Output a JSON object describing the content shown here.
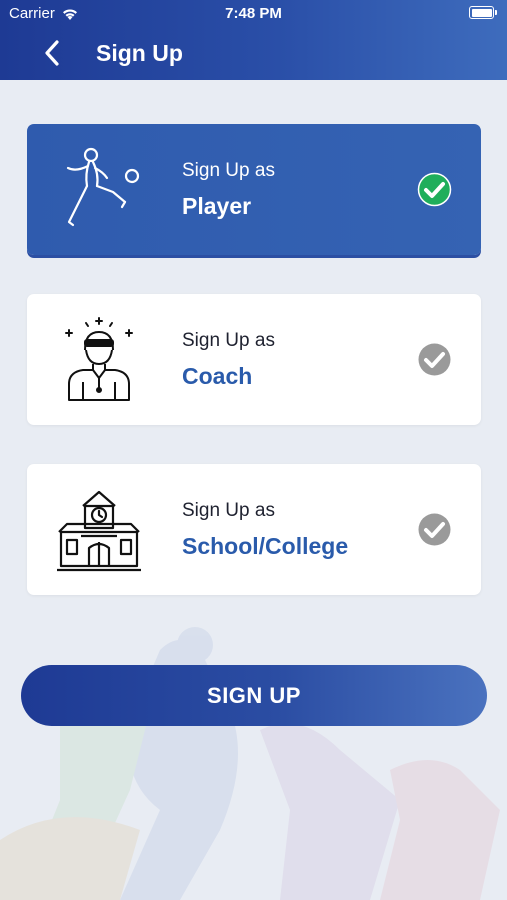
{
  "status_bar": {
    "carrier": "Carrier",
    "time": "7:48 PM"
  },
  "header": {
    "title": "Sign Up"
  },
  "options": [
    {
      "subtitle": "Sign Up as",
      "label": "Player",
      "selected": true
    },
    {
      "subtitle": "Sign Up as",
      "label": "Coach",
      "selected": false
    },
    {
      "subtitle": "Sign Up as",
      "label": "School/College",
      "selected": false
    }
  ],
  "signup_button": {
    "label": "SIGN UP"
  },
  "icons": [
    "wifi-icon",
    "battery-icon",
    "back-arrow-icon",
    "player-icon",
    "coach-icon",
    "school-icon",
    "check-icon"
  ],
  "colors": {
    "primary": "#2a5bab",
    "header": "#1e3a94",
    "selected_card": "#3563b3",
    "check_selected": "#1fae5b",
    "check_unselected": "#9a9a9a",
    "background": "#e8ecf3"
  }
}
